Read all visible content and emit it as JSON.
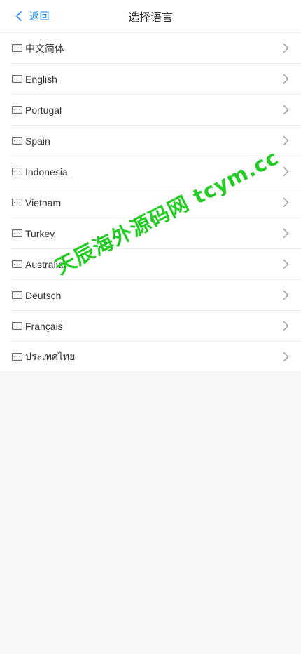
{
  "header": {
    "back_label": "返回",
    "title": "选择语言"
  },
  "languages": [
    {
      "label": "中文简体"
    },
    {
      "label": "English"
    },
    {
      "label": "Portugal"
    },
    {
      "label": "Spain"
    },
    {
      "label": "Indonesia"
    },
    {
      "label": "Vietnam"
    },
    {
      "label": "Turkey"
    },
    {
      "label": "Australia"
    },
    {
      "label": "Deutsch"
    },
    {
      "label": "Français"
    },
    {
      "label": "ประเทศไทย"
    }
  ],
  "icons": {
    "back": "chevron-left-icon",
    "item": "keyboard-icon",
    "arrow": "chevron-right-icon"
  },
  "watermark": "天辰海外源码网 tcym.cc",
  "colors": {
    "accent": "#1989fa",
    "text": "#323233",
    "divider": "#ebedf0",
    "watermark": "#22cc22"
  }
}
